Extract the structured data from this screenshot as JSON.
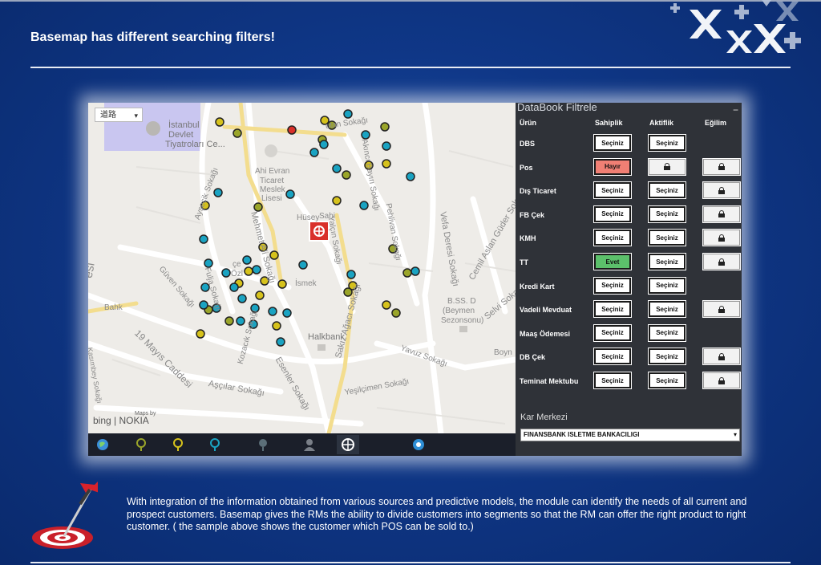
{
  "title": "Basemap has different searching filters!",
  "map": {
    "layer_select": "道路",
    "labels": {
      "istanbul": "İstanbul",
      "devlet": "Devlet",
      "tiyatro": "Tiyatroları Ce...",
      "ahi1": "Ahi Evran",
      "ahi2": "Ticaret",
      "ahi3": "Meslek",
      "ahi4": "Lisesi",
      "ismek": "İsmek",
      "bss1": "B.SS. D",
      "bss2": "(Beymen",
      "bss3": "Sezonsonu)",
      "halkbank": "Halkbank",
      "boyn": "Boyn",
      "desi": "esi",
      "guvan": "Güven Sokağı",
      "mayis": "19 Mayıs Caddesi",
      "ascilar": "Aşçılar Sokağı",
      "esenler": "Esenler Sokağı",
      "kozacik": "Kozacık Sokağı",
      "yesilcimen": "Yeşilçimen Sokağı",
      "yavuz": "Yavuz Sokağı",
      "sakiz": "Sakız Ağacı Sokağı",
      "vefa": "Vefa Deresi Sokağı",
      "cemil": "Cemil Aslan Güder Sokağı",
      "selvi": "Selvi Sokağı",
      "pehlivan": "Pehlivan Sokağı",
      "akinci": "Akıncı Bayırı Sokağı",
      "aysecik": "Ayşecik Sokağı",
      "mehmet": "Mehmet Ali Sokağı",
      "yalcin": "Yalçın Sokağı",
      "hüsey": "Hüsey",
      "sahi": "Sahi",
      "tan": "utan Sokağı",
      "fuljan": "Fulja Sokağı",
      "ozl": "Özl",
      "cek": "çe",
      "kasimbey": "Kasımbey Sokağı",
      "bahk": "Bahk"
    },
    "attribution": {
      "maps_by": "Maps by",
      "brand": "bing | NOKIA"
    }
  },
  "toolbar": {
    "icons": [
      "globe-icon",
      "pin-olive-icon",
      "pin-yellow-icon",
      "pin-teal-icon",
      "pin-dark-icon",
      "person-icon",
      "target-icon",
      "compass-icon"
    ],
    "selected": "target-icon"
  },
  "panel": {
    "title": "DataBook Filtrele",
    "minimize": "−",
    "headers": {
      "urun": "Ürün",
      "sahiplik": "Sahiplik",
      "aktiflik": "Aktiflik",
      "egilim": "Eğilim"
    },
    "rows": [
      {
        "label": "DBS",
        "sahiplik": "Seçiniz",
        "aktiflik": "Seçiniz",
        "egilim": ""
      },
      {
        "label": "Pos",
        "sahiplik": "Hayır",
        "aktiflik": "lock",
        "egilim": "lock"
      },
      {
        "label": "Dış Ticaret",
        "sahiplik": "Seçiniz",
        "aktiflik": "Seçiniz",
        "egilim": "lock"
      },
      {
        "label": "FB Çek",
        "sahiplik": "Seçiniz",
        "aktiflik": "Seçiniz",
        "egilim": "lock"
      },
      {
        "label": "KMH",
        "sahiplik": "Seçiniz",
        "aktiflik": "Seçiniz",
        "egilim": "lock"
      },
      {
        "label": "TT",
        "sahiplik": "Evet",
        "aktiflik": "Seçiniz",
        "egilim": "lock"
      },
      {
        "label": "Kredi Kart",
        "sahiplik": "Seçiniz",
        "aktiflik": "Seçiniz",
        "egilim": ""
      },
      {
        "label": "Vadeli Mevduat",
        "sahiplik": "Seçiniz",
        "aktiflik": "Seçiniz",
        "egilim": "lock"
      },
      {
        "label": "Maaş Ödemesi",
        "sahiplik": "Seçiniz",
        "aktiflik": "Seçiniz",
        "egilim": ""
      },
      {
        "label": "DB Çek",
        "sahiplik": "Seçiniz",
        "aktiflik": "Seçiniz",
        "egilim": "lock"
      },
      {
        "label": "Teminat Mektubu",
        "sahiplik": "Seçiniz",
        "aktiflik": "Seçiniz",
        "egilim": "lock"
      }
    ],
    "kar_merkezi_label": "Kar Merkezi",
    "kar_merkezi_value": "FINANSBANK ISLETME BANKACILIGI"
  },
  "description": "With integration of the information obtained from various sources and predictive models, the module can identify the needs of all current and prospect customers. Basemap gives the RMs the ability to divide customers into segments so that the RM can offer the right product to right customer. ( the sample above shows the customer which POS can be sold to.)",
  "colors": {
    "background": "#0f3787",
    "panel": "#2f3238",
    "hayir": "#f07f74",
    "evet": "#5cc06b",
    "pin_teal": "#1aa3c2",
    "pin_olive": "#9aa52a",
    "pin_yellow": "#d6c21c",
    "pin_red": "#d9302a"
  }
}
